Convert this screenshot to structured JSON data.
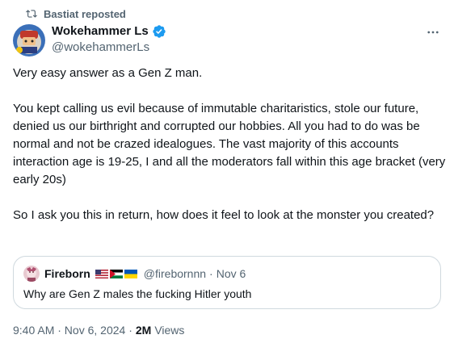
{
  "repost": {
    "label": "Bastiat reposted",
    "icon": "repost-icon"
  },
  "author": {
    "display_name": "Wokehammer Ls",
    "handle": "@wokehammerLs",
    "verified": true,
    "avatar_icon": "avatar"
  },
  "menu": {
    "icon": "more-icon"
  },
  "tweet": {
    "paragraphs": [
      "Very easy answer as a Gen Z man.",
      "You kept calling us evil because of immutable charitaristics, stole our future, denied us our birthright and corrupted our hobbies. All you had to do was be normal and not be crazed idealogues. The vast majority of this accounts interaction age is 19-25, I and all the moderators fall within this age bracket (very early 20s)",
      "So I ask you this in return, how does it feel to look at the monster you created?"
    ]
  },
  "quote": {
    "display_name": "Fireborn",
    "flags": [
      "us-flag",
      "palestine-flag",
      "ukraine-flag"
    ],
    "handle": "@firebornnn",
    "separator": "·",
    "time": "Nov 6",
    "text": "Why are Gen Z males the fucking Hitler youth"
  },
  "meta": {
    "timestamp": "9:40 AM · Nov 6, 2024 ·",
    "views_count": "2M",
    "views_label": "Views"
  },
  "colors": {
    "text_primary": "#0f1419",
    "text_secondary": "#536471",
    "verified_blue": "#1d9bf0",
    "border": "#cfd9de"
  }
}
